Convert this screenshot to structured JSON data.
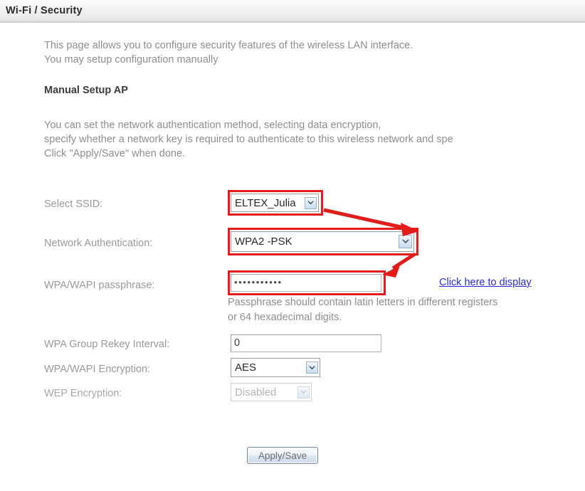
{
  "header": {
    "title": "Wi-Fi / Security"
  },
  "intro": {
    "line1": "This page allows you to configure security features of the wireless LAN interface.",
    "line2": "You may setup configuration manually"
  },
  "section": {
    "heading": "Manual Setup AP"
  },
  "detail": {
    "line1": "You can set the network authentication method, selecting data encryption,",
    "line2": "specify whether a network key is required to authenticate to this wireless network and spe",
    "line3": "Click \"Apply/Save\" when done."
  },
  "form": {
    "ssid": {
      "label": "Select SSID:",
      "value": "ELTEX_Julia",
      "arrow_icon": "chevron-down-icon"
    },
    "network_auth": {
      "label": "Network Authentication:",
      "value": "WPA2 -PSK",
      "arrow_icon": "chevron-down-icon"
    },
    "passphrase": {
      "label": "WPA/WAPI passphrase:",
      "value": "•••••••••••",
      "link": "Click here to display",
      "hint_line1": "Passphrase should contain latin letters in different registers",
      "hint_line2": "or 64 hexadecimal digits."
    },
    "rekey": {
      "label": "WPA Group Rekey Interval:",
      "value": "0"
    },
    "encryption": {
      "label": "WPA/WAPI Encryption:",
      "value": "AES",
      "arrow_icon": "chevron-down-icon"
    },
    "wep": {
      "label": "WEP Encryption:",
      "value": "Disabled",
      "arrow_icon": "chevron-down-icon"
    }
  },
  "actions": {
    "apply_save": "Apply/Save"
  },
  "annotations": {
    "highlight_color": "#e21b1b",
    "boxes": [
      "ssid-select",
      "network-auth-select",
      "passphrase-input"
    ],
    "arrows": [
      "ssid-to-auth-arrow",
      "auth-to-passphrase-arrow"
    ]
  }
}
